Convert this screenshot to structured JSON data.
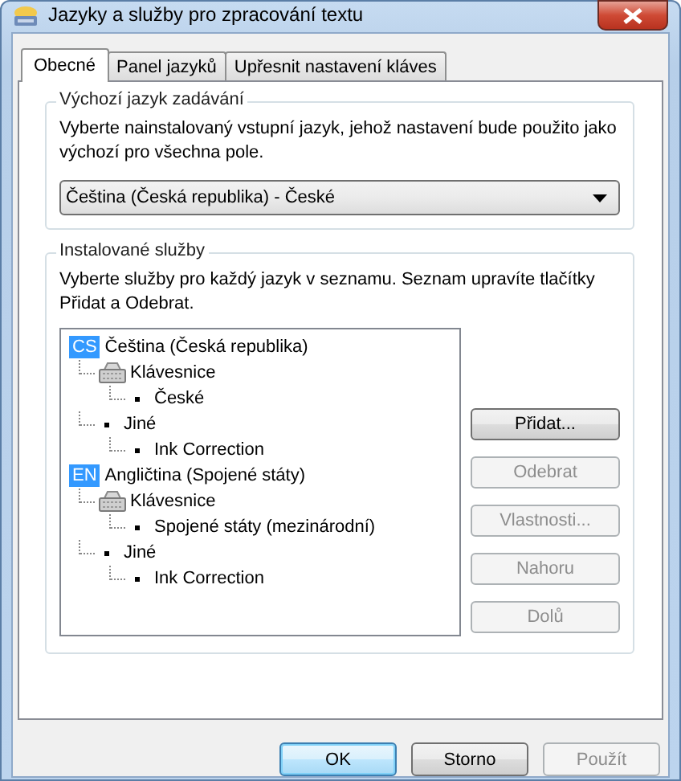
{
  "window": {
    "title": "Jazyky a služby pro zpracování textu"
  },
  "tabs": [
    {
      "label": "Obecné",
      "selected": true
    },
    {
      "label": "Panel jazyků",
      "selected": false
    },
    {
      "label": "Upřesnit nastavení kláves",
      "selected": false
    }
  ],
  "default_language": {
    "title": "Výchozí jazyk zadávání",
    "description": "Vyberte nainstalovaný vstupní jazyk, jehož nastavení bude použito jako výchozí pro všechna pole.",
    "value": "Čeština (Česká republika) - České"
  },
  "installed_services": {
    "title": "Instalované služby",
    "description": "Vyberte služby pro každý jazyk v seznamu. Seznam upravíte tlačítky Přidat a Odebrat.",
    "tree": [
      {
        "kind": "language",
        "badge": "CS",
        "label": "Čeština (Česká republika)",
        "children": [
          {
            "kind": "keyboard",
            "label": "Klávesnice",
            "children": [
              {
                "kind": "bullet",
                "label": "České"
              }
            ]
          },
          {
            "kind": "bullet",
            "label": "Jiné",
            "children": [
              {
                "kind": "bullet",
                "label": "Ink Correction"
              }
            ]
          }
        ]
      },
      {
        "kind": "language",
        "badge": "EN",
        "label": "Angličtina (Spojené státy)",
        "children": [
          {
            "kind": "keyboard",
            "label": "Klávesnice",
            "children": [
              {
                "kind": "bullet",
                "label": "Spojené státy (mezinárodní)"
              }
            ]
          },
          {
            "kind": "bullet",
            "label": "Jiné",
            "children": [
              {
                "kind": "bullet",
                "label": "Ink Correction"
              }
            ]
          }
        ]
      }
    ],
    "buttons": [
      {
        "label": "Přidat...",
        "disabled": false
      },
      {
        "label": "Odebrat",
        "disabled": true
      },
      {
        "label": "Vlastnosti...",
        "disabled": true
      },
      {
        "label": "Nahoru",
        "disabled": true
      },
      {
        "label": "Dolů",
        "disabled": true
      }
    ]
  },
  "dialog_buttons": [
    {
      "label": "OK",
      "default": true,
      "disabled": false
    },
    {
      "label": "Storno",
      "default": false,
      "disabled": false
    },
    {
      "label": "Použít",
      "default": false,
      "disabled": true
    }
  ]
}
